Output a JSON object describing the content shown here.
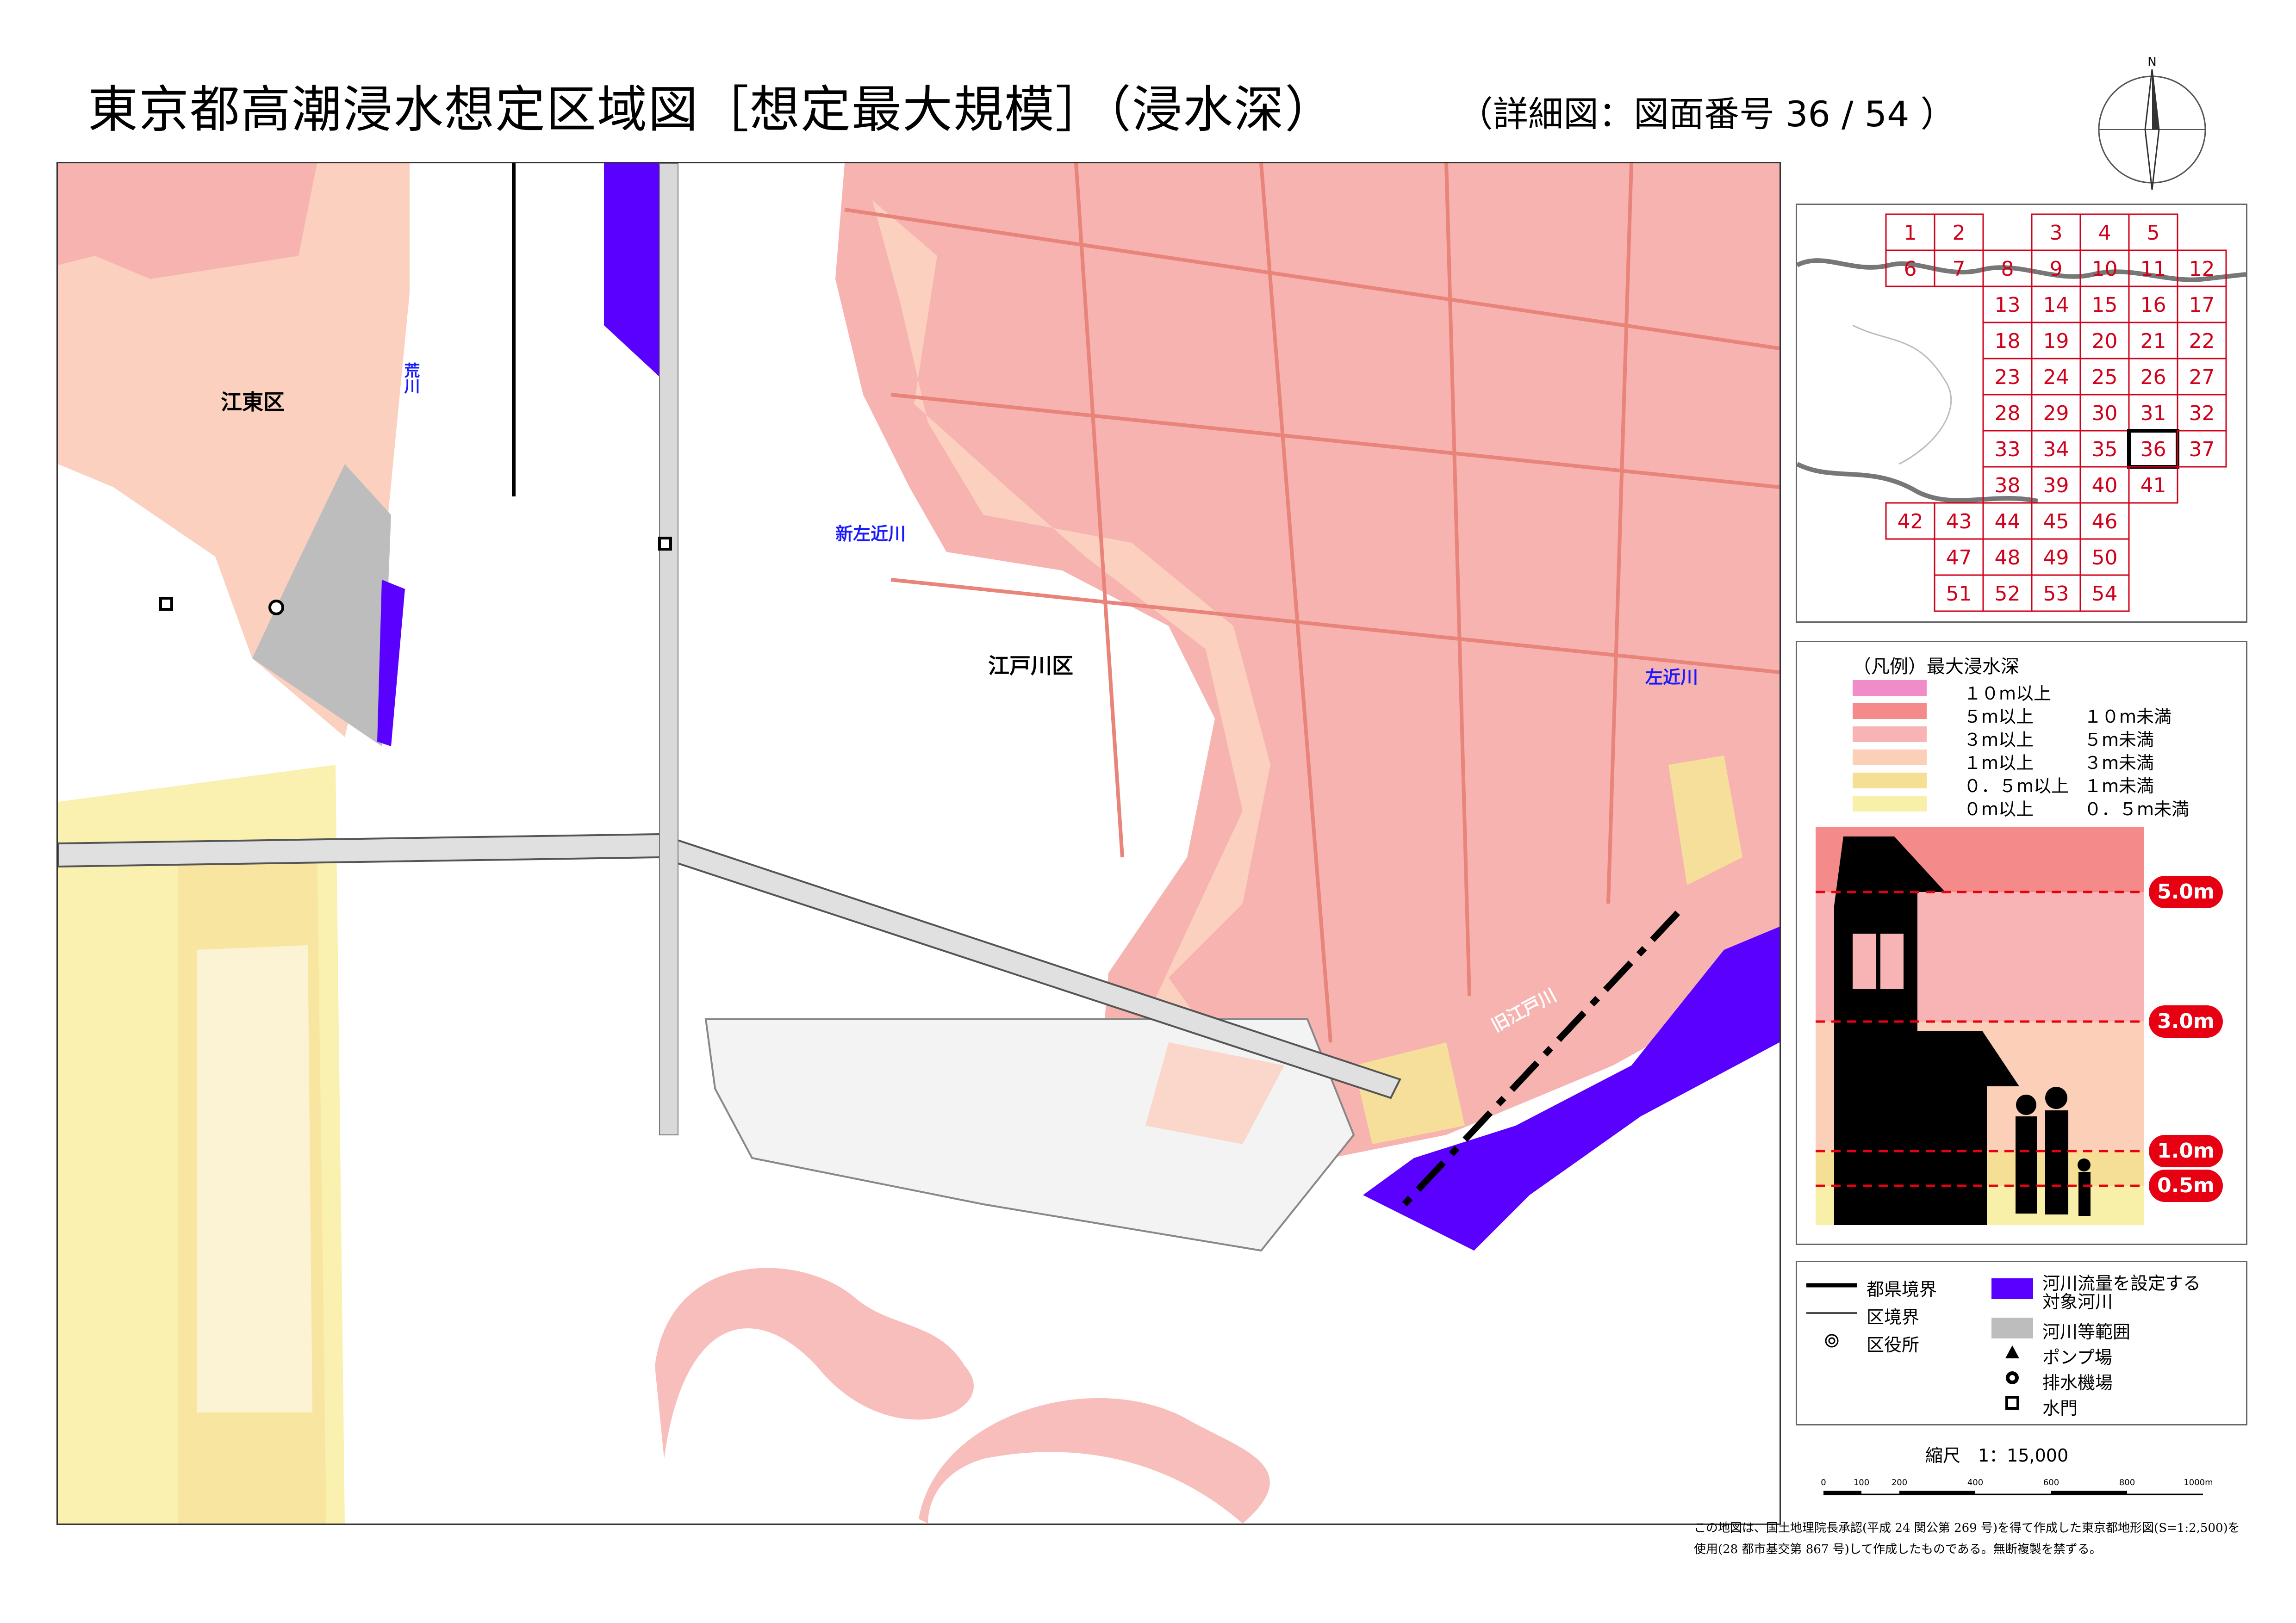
{
  "title": "東京都高潮浸水想定区域図［想定最大規模］（浸水深）",
  "subtitle": "（詳細図：図面番号 36 / 54 ）",
  "compass": {
    "label": "N"
  },
  "map": {
    "labels": [
      {
        "key": "koto",
        "text": "江東区",
        "color": "#000"
      },
      {
        "key": "arakawa",
        "text": "荒川",
        "color": "#1a1aff"
      },
      {
        "key": "shinsakon",
        "text": "新左近川",
        "color": "#1a1aff"
      },
      {
        "key": "edogawa",
        "text": "江戸川区",
        "color": "#000"
      },
      {
        "key": "sakon",
        "text": "左近川",
        "color": "#1a1aff"
      },
      {
        "key": "kyuedo",
        "text": "旧江戸川",
        "color": "#ffffff"
      }
    ],
    "colors": {
      "river_target": "#5a00ff",
      "river_area": "#bdbdbd",
      "depth_3_5": "#f6b3b0",
      "depth_1_3": "#fbd0bf",
      "depth_05_1": "#f6df9a",
      "depth_0_05": "#faf0b0",
      "road": "#e8847a"
    }
  },
  "index": {
    "rows": [
      [
        "1",
        "2",
        "",
        "3",
        "4",
        "5",
        ""
      ],
      [
        "6",
        "7",
        "8",
        "9",
        "10",
        "11",
        "12"
      ],
      [
        "",
        "",
        "13",
        "14",
        "15",
        "16",
        "17"
      ],
      [
        "",
        "",
        "18",
        "19",
        "20",
        "21",
        "22"
      ],
      [
        "",
        "",
        "23",
        "24",
        "25",
        "26",
        "27"
      ],
      [
        "",
        "",
        "28",
        "29",
        "30",
        "31",
        "32"
      ],
      [
        "",
        "",
        "33",
        "34",
        "35",
        "36",
        "37"
      ],
      [
        "",
        "",
        "38",
        "39",
        "40",
        "41",
        ""
      ],
      [
        "42",
        "43",
        "44",
        "45",
        "46",
        "",
        ""
      ],
      [
        "",
        "47",
        "48",
        "49",
        "50",
        "",
        ""
      ],
      [
        "",
        "51",
        "52",
        "53",
        "54",
        "",
        ""
      ]
    ],
    "current": "36",
    "grid_color": "#d0021b"
  },
  "legend": {
    "title": "（凡例）最大浸水深",
    "rows": [
      {
        "a": "１０m以上",
        "b": "",
        "color": "#f08cc8"
      },
      {
        "a": "５m以上",
        "b": "１０m未満",
        "color": "#f58a8a"
      },
      {
        "a": "３m以上",
        "b": "５m未満",
        "color": "#f8b4b4"
      },
      {
        "a": "１m以上",
        "b": "３m未満",
        "color": "#fbcfb8"
      },
      {
        "a": "０．５m以上",
        "b": "１m未満",
        "color": "#f5df95"
      },
      {
        "a": "０m以上",
        "b": "０．５m未満",
        "color": "#f8f0a8"
      }
    ],
    "depth_labels": [
      "5.0m",
      "3.0m",
      "1.0m",
      "0.5m"
    ]
  },
  "symbols": {
    "prefecture_border": "都県境界",
    "ward_border": "区境界",
    "ward_office": "区役所",
    "target_river": "河川流量を設定する\n対象河川",
    "target_river_line1": "河川流量を設定する",
    "target_river_line2": "対象河川",
    "river_area": "河川等範囲",
    "pump": "ポンプ場",
    "drainage": "排水機場",
    "sluice": "水門"
  },
  "scale": {
    "label": "縮尺　1：15,000",
    "ticks": [
      "0",
      "100",
      "200",
      "400",
      "600",
      "800",
      "1000m"
    ]
  },
  "credit": {
    "line1": "この地図は、国土地理院長承認(平成 24 関公第 269 号)を得て作成した東京都地形図(S=1:2,500)を",
    "line2": "使用(28 都市基交第 867 号)して作成したものである。無断複製を禁ずる。"
  }
}
